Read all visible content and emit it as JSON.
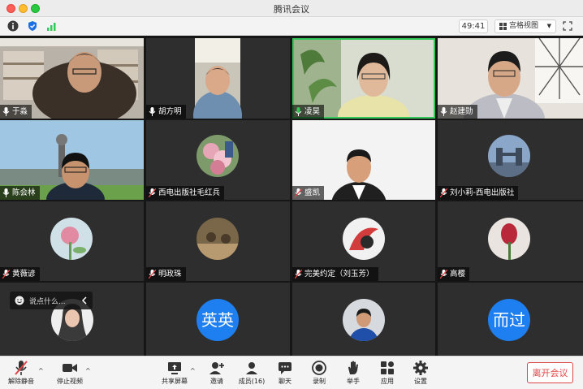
{
  "window": {
    "title": "腾讯会议"
  },
  "infobar": {
    "icons": [
      "info-icon",
      "shield-icon",
      "signal-icon"
    ],
    "timer": "49:41",
    "view_label": "宫格视图",
    "view_caret": "▼"
  },
  "participants": [
    {
      "name": "于淼",
      "avatar": "video"
    },
    {
      "name": "胡方明",
      "avatar": "video"
    },
    {
      "name": "凌昊",
      "avatar": "video",
      "speaking": true
    },
    {
      "name": "赵建勋",
      "avatar": "video"
    },
    {
      "name": "陈会林",
      "avatar": "video"
    },
    {
      "name": "西电出版社毛红兵",
      "avatar": "photo"
    },
    {
      "name": "盛凯",
      "avatar": "video"
    },
    {
      "name": "刘小莉-西电出版社",
      "avatar": "photo"
    },
    {
      "name": "黄薇谚",
      "avatar": "photo"
    },
    {
      "name": "明政珠",
      "avatar": "photo"
    },
    {
      "name": "完美约定（刘玉芳）",
      "avatar": "photo"
    },
    {
      "name": "高樱",
      "avatar": "photo"
    },
    {
      "name": "",
      "avatar": "photo"
    },
    {
      "name": "",
      "avatar": "text",
      "avatar_text": "英英"
    },
    {
      "name": "",
      "avatar": "photo"
    },
    {
      "name": "",
      "avatar": "text",
      "avatar_text": "而过"
    }
  ],
  "chat_popup": {
    "placeholder": "说点什么..."
  },
  "toolbar": {
    "unmute": "解除静音",
    "stop_video": "停止视频",
    "share_screen": "共享屏幕",
    "invite": "邀请",
    "members": "成员(16)",
    "chat": "聊天",
    "record": "录制",
    "raise_hand": "举手",
    "apps": "应用",
    "settings": "设置",
    "leave": "离开会议"
  },
  "colors": {
    "accent_blue": "#1e7ff0",
    "speaking_border": "#34c759",
    "leave_red": "#e04545"
  }
}
